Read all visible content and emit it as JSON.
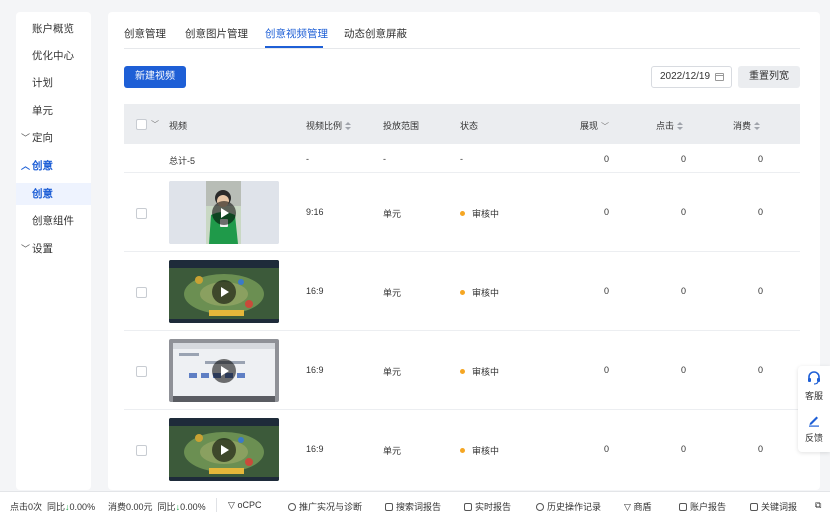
{
  "sidebar": {
    "items": [
      {
        "label": "账户概览"
      },
      {
        "label": "优化中心"
      },
      {
        "label": "计划"
      },
      {
        "label": "单元"
      },
      {
        "label": "定向"
      },
      {
        "label": "创意"
      },
      {
        "label": "创意"
      },
      {
        "label": "创意组件"
      },
      {
        "label": "设置"
      }
    ]
  },
  "tabs": [
    {
      "label": "创意管理"
    },
    {
      "label": "创意图片管理"
    },
    {
      "label": "创意视频管理"
    },
    {
      "label": "动态创意屏蔽"
    }
  ],
  "toolbar": {
    "new_video": "新建视频",
    "date": "2022/12/19",
    "reset_columns": "重置列宽"
  },
  "table": {
    "headers": {
      "video": "视频",
      "ratio": "视频比例",
      "scope": "投放范围",
      "status": "状态",
      "impressions": "展现",
      "clicks": "点击",
      "cost": "消费"
    },
    "total": {
      "label": "总计-5",
      "ratio": "-",
      "scope": "-",
      "status": "-",
      "impressions": "0",
      "clicks": "0",
      "cost": "0"
    },
    "rows": [
      {
        "ratio": "9:16",
        "scope": "单元",
        "status": "审核中",
        "impressions": "0",
        "clicks": "0",
        "cost": "0"
      },
      {
        "ratio": "16:9",
        "scope": "单元",
        "status": "审核中",
        "impressions": "0",
        "clicks": "0",
        "cost": "0"
      },
      {
        "ratio": "16:9",
        "scope": "单元",
        "status": "审核中",
        "impressions": "0",
        "clicks": "0",
        "cost": "0"
      },
      {
        "ratio": "16:9",
        "scope": "单元",
        "status": "审核中",
        "impressions": "0",
        "clicks": "0",
        "cost": "0"
      }
    ]
  },
  "float": {
    "service": "客服",
    "feedback": "反馈"
  },
  "bottom": {
    "clicks": "点击0次",
    "clicks_yoy_label": "同比",
    "clicks_yoy": "0.00%",
    "cost": "消费0.00元",
    "cost_yoy_label": "同比",
    "cost_yoy": "0.00%",
    "ocpc": "oCPC",
    "promo": "推广实况与诊断",
    "search_report": "搜索词报告",
    "realtime": "实时报告",
    "history": "历史操作记录",
    "shangdun": "商盾",
    "account_report": "账户报告",
    "keyword_report": "关键词报"
  },
  "colors": {
    "accent": "#1e5fd6",
    "status_pending": "#f5a623",
    "down": "#22a94e"
  },
  "icons": [
    "chevron-down-icon",
    "chevron-up-icon",
    "calendar-icon",
    "sort-icon",
    "play-icon",
    "headset-icon",
    "edit-icon",
    "funnel-icon",
    "compass-icon",
    "report-icon",
    "clock-icon",
    "external-link-icon"
  ]
}
